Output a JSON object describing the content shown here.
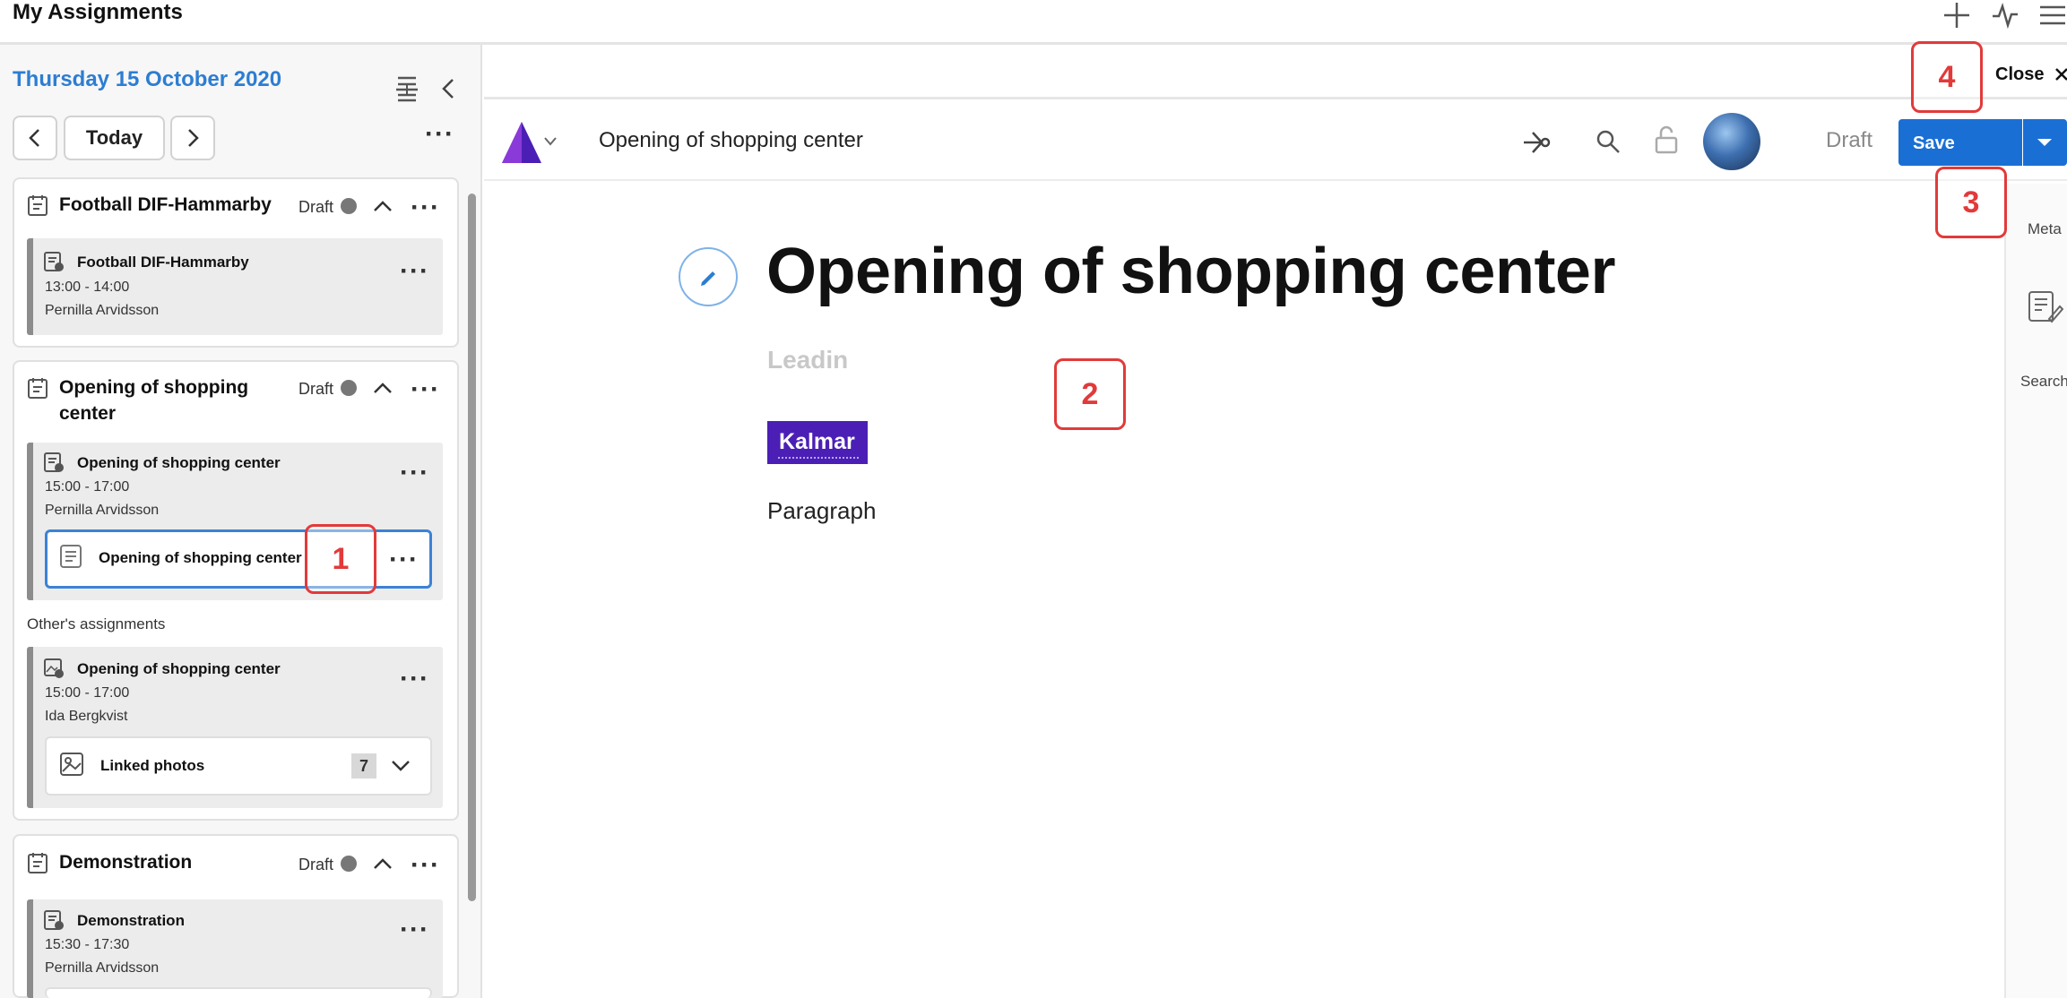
{
  "header": {
    "title": "My Assignments"
  },
  "left_panel": {
    "date": "Thursday 15 October 2020",
    "today_label": "Today",
    "groups": [
      {
        "title": "Football DIF-Hammarby",
        "status": "Draft",
        "assignments": [
          {
            "title": "Football DIF-Hammarby",
            "time": "13:00 - 14:00",
            "person": "Pernilla Arvidsson"
          }
        ]
      },
      {
        "title": "Opening of shopping center",
        "status": "Draft",
        "assignments": [
          {
            "title": "Opening of shopping center",
            "time": "15:00 - 17:00",
            "person": "Pernilla Arvidsson",
            "article": "Opening of shopping center"
          }
        ],
        "others_label": "Other's assignments",
        "others": [
          {
            "title": "Opening of shopping center",
            "time": "15:00 - 17:00",
            "person": "Ida Bergkvist",
            "linked_label": "Linked photos",
            "linked_count": "7"
          }
        ]
      },
      {
        "title": "Demonstration",
        "status": "Draft",
        "assignments": [
          {
            "title": "Demonstration",
            "time": "15:30 - 17:30",
            "person": "Pernilla Arvidsson"
          }
        ]
      }
    ]
  },
  "editor": {
    "close_label": "Close",
    "doc_name": "Opening of shopping center",
    "status": "Draft",
    "save_label": "Save",
    "headline": "Opening of shopping center",
    "leadin_placeholder": "Leadin",
    "tag": "Kalmar",
    "paragraph": "Paragraph"
  },
  "right_sidebar": {
    "meta_label": "Meta",
    "search_label": "Search"
  },
  "markers": [
    "1",
    "2",
    "3",
    "4"
  ],
  "colors": {
    "accent": "#2d7dd2",
    "save": "#1a6fd4",
    "tag": "#4b1fb5",
    "marker": "#e23a3a"
  }
}
